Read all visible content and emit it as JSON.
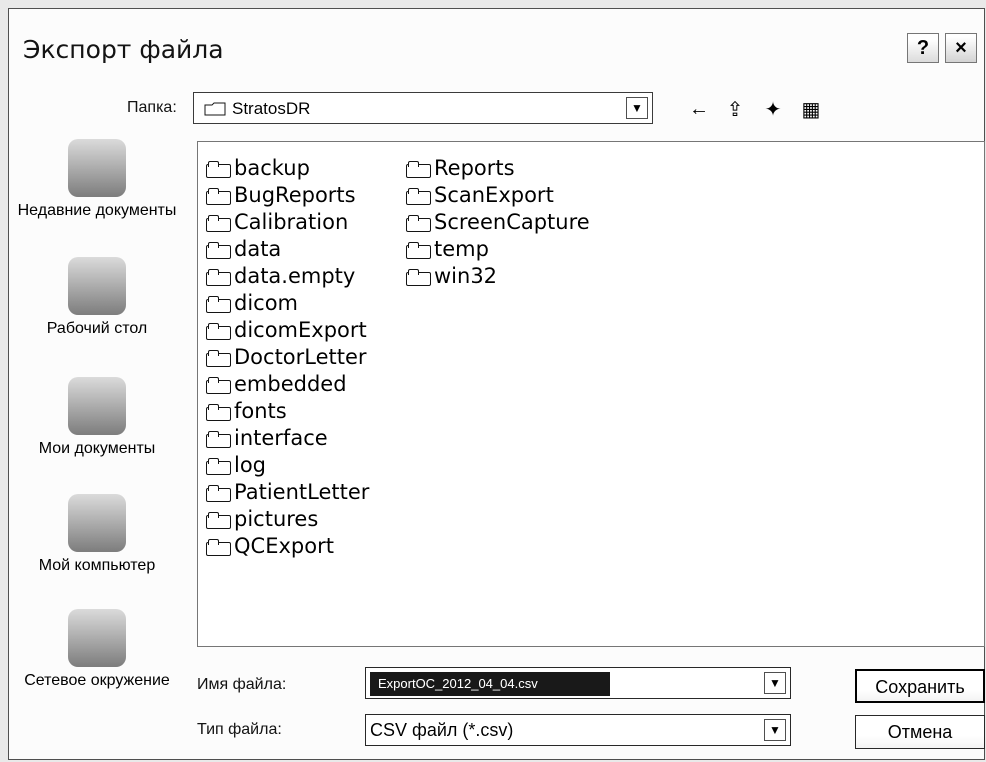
{
  "dialog": {
    "title": "Экспорт файла",
    "help_label": "?",
    "close_label": "×"
  },
  "folder": {
    "label": "Папка:",
    "current": "StratosDR"
  },
  "sidebar": [
    {
      "label": "Недавние документы",
      "icon": "recent-documents-icon"
    },
    {
      "label": "Рабочий стол",
      "icon": "desktop-icon"
    },
    {
      "label": "Мои документы",
      "icon": "my-documents-icon"
    },
    {
      "label": "Мой компьютер",
      "icon": "my-computer-icon"
    },
    {
      "label": "Сетевое окружение",
      "icon": "network-icon"
    }
  ],
  "files": {
    "column1": [
      "backup",
      "BugReports",
      "Calibration",
      "data",
      "data.empty",
      "dicom",
      "dicomExport",
      "DoctorLetter",
      "embedded",
      "fonts",
      "interface",
      "log",
      "PatientLetter",
      "pictures",
      "QCExport"
    ],
    "column2": [
      "Reports",
      "ScanExport",
      "ScreenCapture",
      "temp",
      "win32"
    ]
  },
  "file_name": {
    "label": "Имя файла:",
    "value": "ExportOC_2012_04_04.csv"
  },
  "file_type": {
    "label": "Тип файла:",
    "value": "CSV файл (*.csv)"
  },
  "buttons": {
    "save": "Сохранить",
    "cancel": "Отмена"
  }
}
